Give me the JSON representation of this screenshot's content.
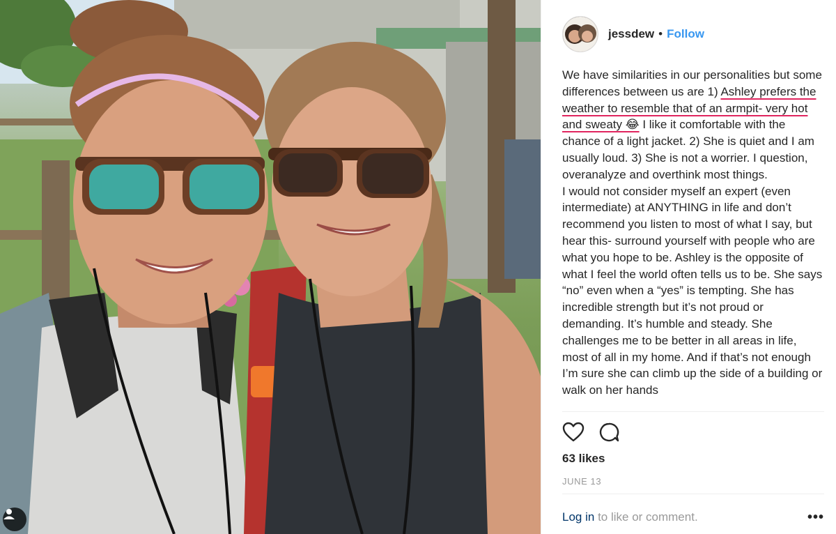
{
  "post": {
    "username": "jessdew",
    "separator": "•",
    "follow_label": "Follow",
    "caption": {
      "before": "We have similarities in our personalities but some differences between us are 1) ",
      "underlined": "Ashley prefers the weather to resemble that of an armpit- very hot and sweaty 😂",
      "after": " I like it comfortable with the chance of a light jacket. 2) She is quiet and I am usually loud. 3) She is not a worrier. I question, overanalyze and overthink most things.\nI would not consider myself an expert (even intermediate) at ANYTHING in life and don’t recommend you listen to most of what I say, but hear this- surround yourself with people who are what you hope to be. Ashley is the opposite of what I feel the world often tells us to be. She says “no” even when a “yes” is tempting. She has incredible strength but it’s not proud or demanding. It’s humble and steady. She challenges me to be better in all areas in life, most of all in my home. And if that’s not enough I’m sure she can climb up the side of a building or walk on her hands"
    },
    "likes": "63 likes",
    "date": "JUNE 13",
    "login_link": "Log in",
    "login_rest": "to like or comment.",
    "more_label": "•••"
  },
  "icons": {
    "like": "heart-icon",
    "comment": "comment-bubble-icon",
    "tagged_users": "user-tag-icon"
  },
  "colors": {
    "link_blue": "#3897f0",
    "login_blue": "#003569",
    "muted": "#999999",
    "underline_accent": "#e0245e"
  }
}
